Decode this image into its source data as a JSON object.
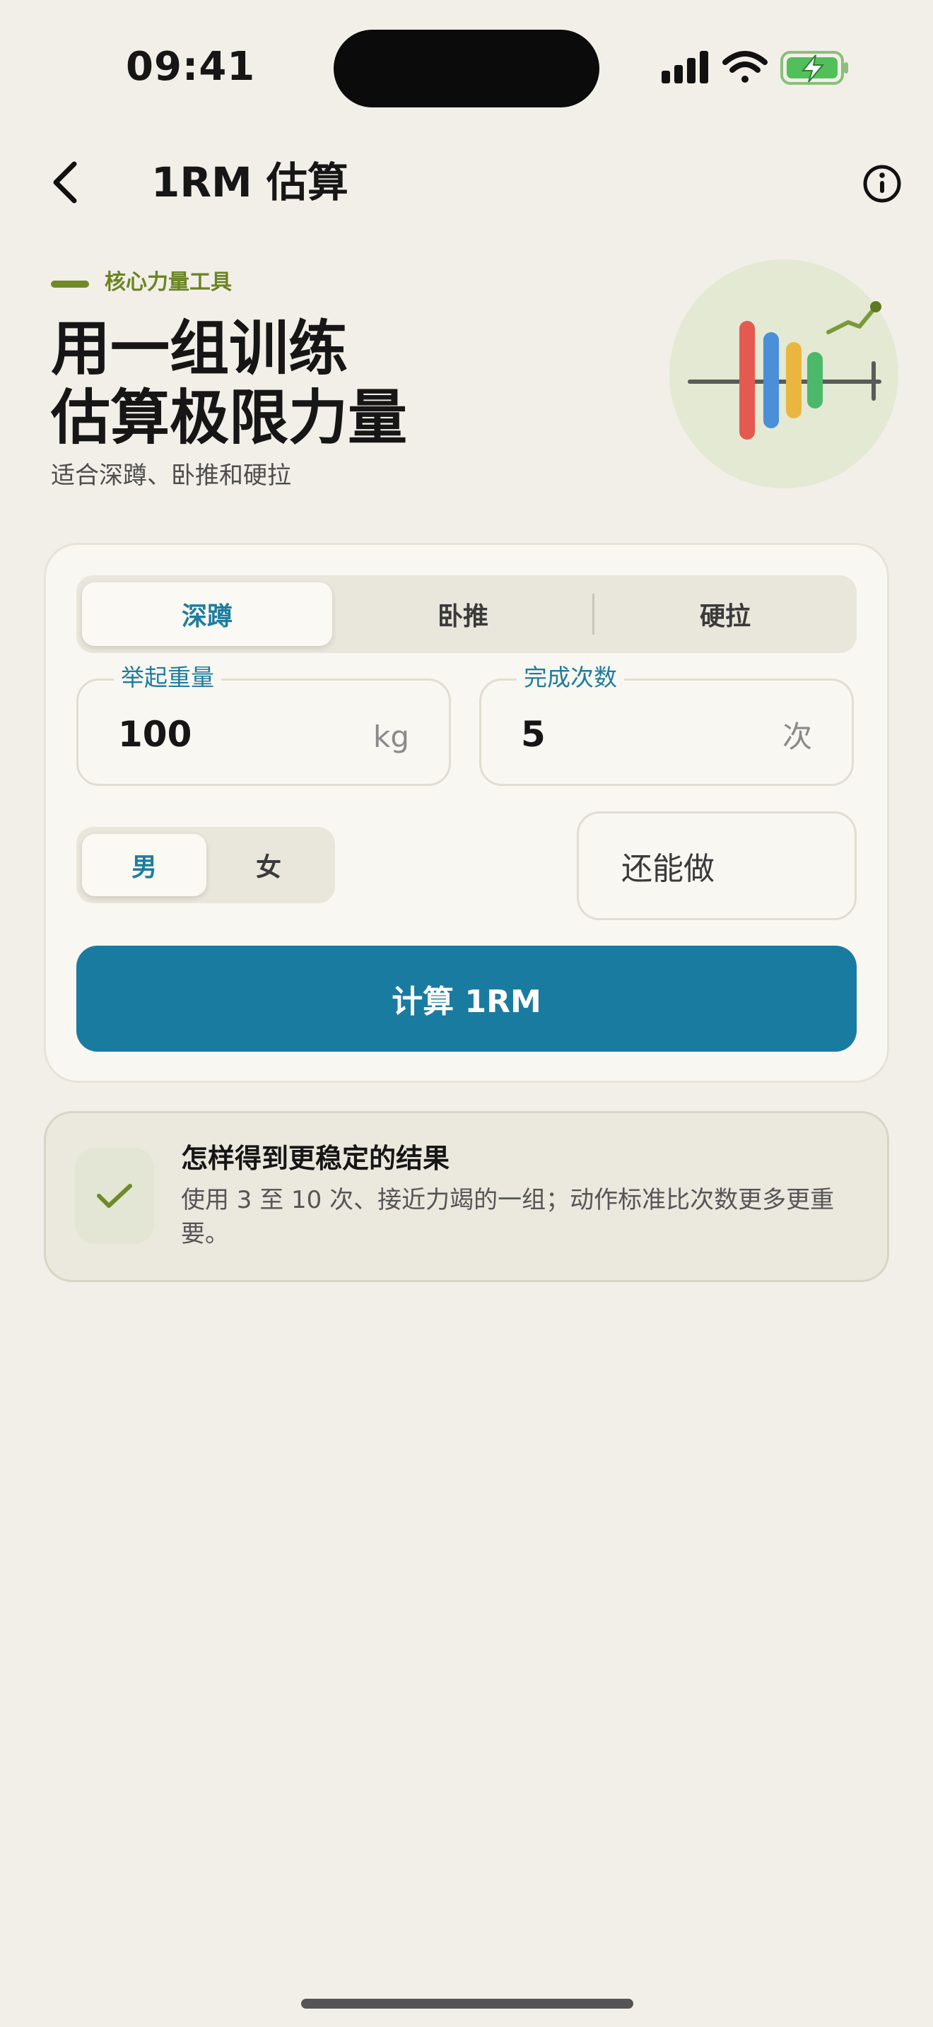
{
  "status_bar": {
    "time": "09:41",
    "icons": [
      "signal-icon",
      "wifi-icon",
      "battery-charging-icon"
    ]
  },
  "nav": {
    "title": "1RM 估算",
    "back_icon": "chevron-left-icon",
    "info_icon": "info-icon"
  },
  "hero": {
    "eyebrow": "核心力量工具",
    "headline_line1": "用一组训练",
    "headline_line2": "估算极限力量",
    "subtitle": "适合深蹲、卧推和硬拉",
    "illustration": "barbell-chart-illustration"
  },
  "exercise_tabs": [
    {
      "label": "深蹲",
      "active": true
    },
    {
      "label": "卧推",
      "active": false
    },
    {
      "label": "硬拉",
      "active": false
    }
  ],
  "weight_field": {
    "label": "举起重量",
    "value": "100",
    "unit": "kg"
  },
  "reps_field": {
    "label": "完成次数",
    "value": "5",
    "unit": "次"
  },
  "gender": [
    {
      "label": "男",
      "active": true
    },
    {
      "label": "女",
      "active": false
    }
  ],
  "more_reps_button": "还能做",
  "calculate_button": "计算 1RM",
  "tip": {
    "icon": "check-icon",
    "title": "怎样得到更稳定的结果",
    "text": "使用 3 至 10 次、接近力竭的一组；动作标准比次数更多更重要。"
  },
  "colors": {
    "background": "#f2efe8",
    "accent_blue": "#1a7ba0",
    "accent_green": "#6f8a26",
    "card": "#f9f7f2"
  }
}
